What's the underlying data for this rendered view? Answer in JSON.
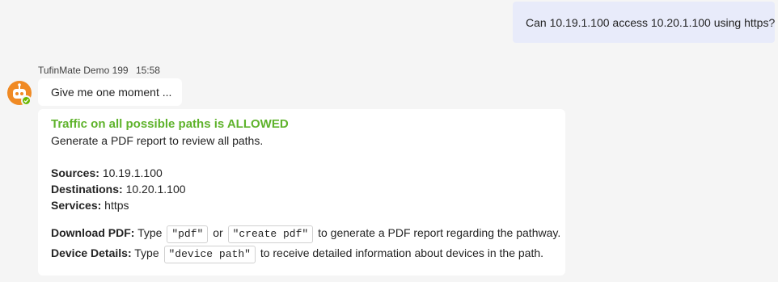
{
  "user_message": {
    "text": "Can 10.19.1.100 access 10.20.1.100 using https?"
  },
  "bot": {
    "name": "TufinMate Demo 199",
    "time": "15:58",
    "avatar_icon": "robot-avatar-icon",
    "presence_color": "#6bb700",
    "avatar_color": "#f08a24"
  },
  "short_message": {
    "text": "Give me one moment ..."
  },
  "card": {
    "status": "Traffic on all possible paths is ALLOWED",
    "status_color": "#5fb32c",
    "subtitle": "Generate a PDF report to review all paths.",
    "sources_label": "Sources:",
    "sources_value": "10.19.1.100",
    "destinations_label": "Destinations:",
    "destinations_value": "10.20.1.100",
    "services_label": "Services:",
    "services_value": "https",
    "download_label": "Download PDF:",
    "download_type": "Type",
    "download_code1": "\"pdf\"",
    "download_or": "or",
    "download_code2": "\"create pdf\"",
    "download_suffix": "to generate a PDF report regarding the pathway.",
    "device_label": "Device Details:",
    "device_type": "Type",
    "device_code": "\"device path\"",
    "device_suffix": "to receive detailed information about devices in the path."
  }
}
